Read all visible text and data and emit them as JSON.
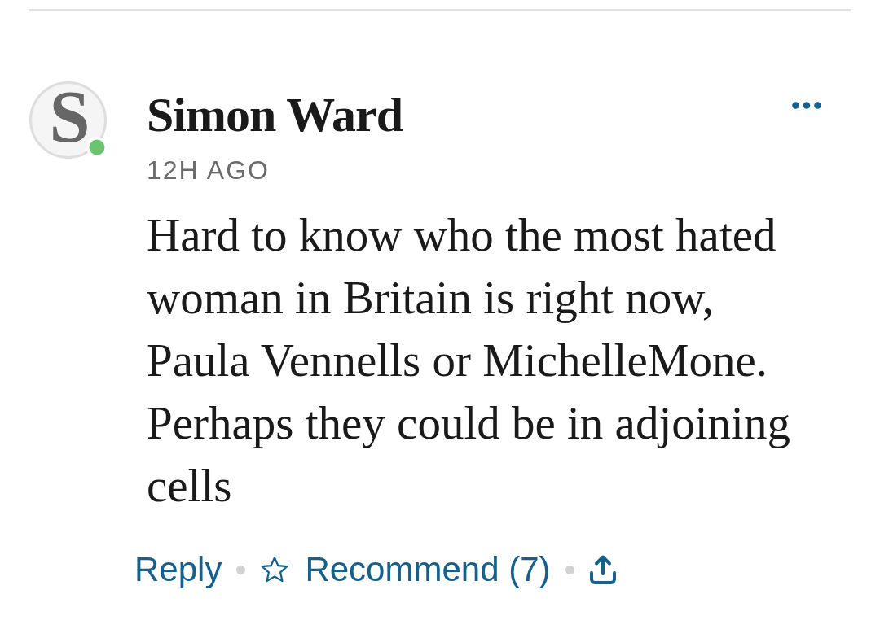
{
  "comment": {
    "author": {
      "initial": "S",
      "name": "Simon Ward",
      "online": true
    },
    "time": "12H AGO",
    "text": "Hard to know who the most hated woman in Britain is right now, Paula Vennells or MichelleMone. Perhaps they could be in adjoining cells",
    "actions": [
      {
        "kind": "reply",
        "label": "Reply"
      },
      {
        "kind": "recommend",
        "label": "Recommend (7)"
      },
      {
        "kind": "share"
      }
    ]
  }
}
